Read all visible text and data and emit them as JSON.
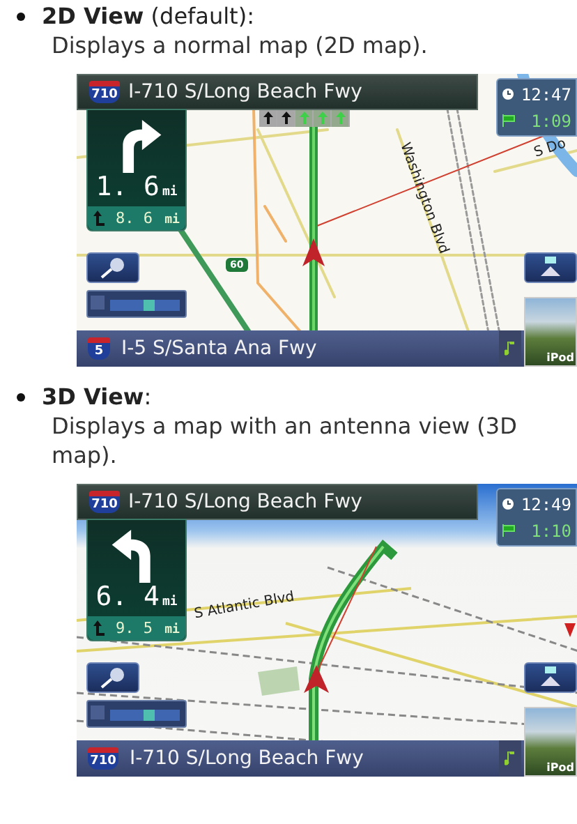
{
  "views": [
    {
      "heading": "**2D View** (default):",
      "description": "Displays a normal map (2D map).",
      "screen": {
        "kind": "flat",
        "street_shield": "710",
        "street": "I-710 S/Long Beach Fwy",
        "turn_left": false,
        "distance": "1. 6",
        "distance_unit": "mi",
        "next_distance": "8. 6",
        "next_unit": "mi",
        "clock": "12:47",
        "remaining": "1:09",
        "lanes": [
          {
            "recommended": false
          },
          {
            "recommended": false
          },
          {
            "recommended": true
          },
          {
            "recommended": true
          },
          {
            "recommended": true
          }
        ],
        "map_labels": [
          {
            "kind": "street",
            "text": "Washington Blvd"
          },
          {
            "kind": "street-edge",
            "text": "S Do"
          },
          {
            "kind": "shield",
            "text": "60"
          }
        ],
        "bottom_shield": "5",
        "bottom_street": "I-5 S/Santa Ana Fwy",
        "source": "iPod"
      }
    },
    {
      "heading": "**3D View**:",
      "description": "Displays a map with an antenna view (3D map).",
      "screen": {
        "kind": "perspective",
        "street_shield": "710",
        "street": "I-710 S/Long Beach Fwy",
        "turn_left": true,
        "distance": "6. 4",
        "distance_unit": "mi",
        "next_distance": "9. 5",
        "next_unit": "mi",
        "clock": "12:49",
        "remaining": "1:10",
        "map_labels": [
          {
            "kind": "street-3d",
            "text": "S Atlantic Blvd"
          }
        ],
        "bottom_shield": "710",
        "bottom_street": "I-710 S/Long Beach Fwy",
        "source": "iPod"
      }
    }
  ]
}
